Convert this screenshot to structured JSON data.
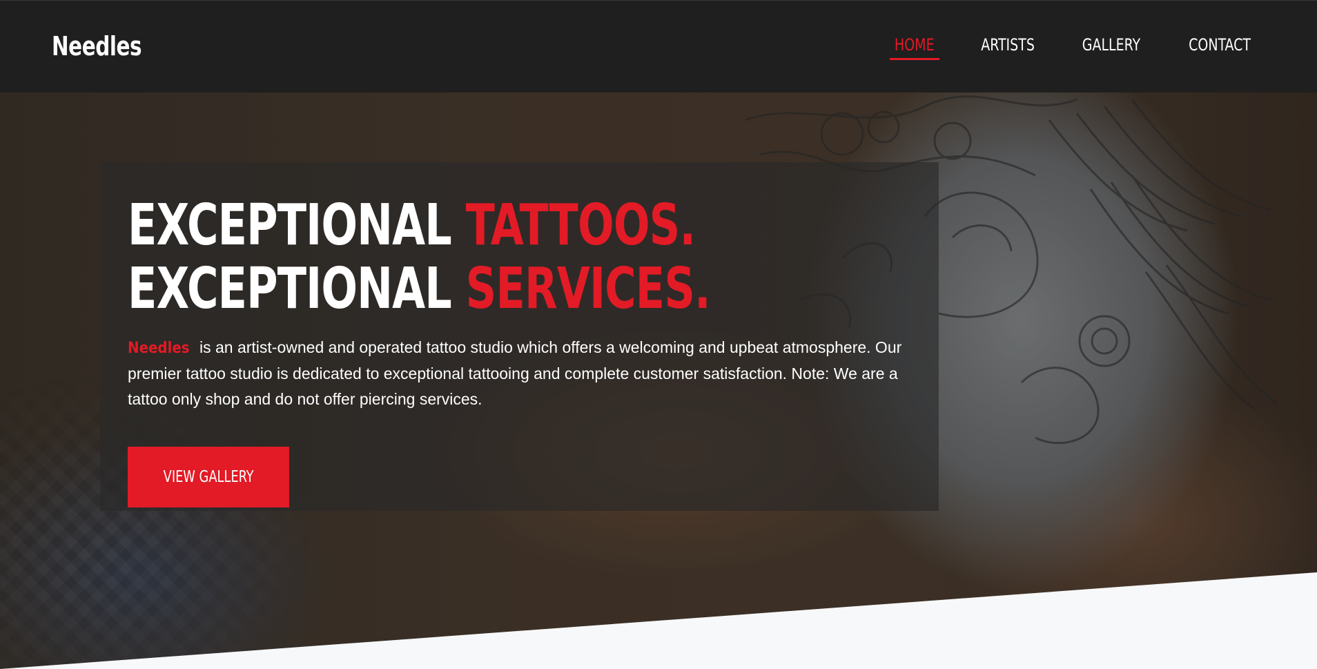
{
  "brand": {
    "name": "Needles"
  },
  "nav": {
    "items": [
      {
        "label": "HOME",
        "active": true
      },
      {
        "label": "ARTISTS",
        "active": false
      },
      {
        "label": "GALLERY",
        "active": false
      },
      {
        "label": "CONTACT",
        "active": false
      }
    ]
  },
  "hero": {
    "headline_line1_a": "EXCEPTIONAL ",
    "headline_line1_b": "TATTOOS.",
    "headline_line2_a": "EXCEPTIONAL ",
    "headline_line2_b": "SERVICES.",
    "description_brand": "Needles",
    "description_text": "is an artist-owned and operated tattoo studio which offers a welcoming and upbeat atmosphere. Our premier tattoo studio is dedicated to exceptional tattooing and complete customer satisfaction. Note: We are a tattoo only shop and do not offer piercing services.",
    "cta_label": "VIEW GALLERY"
  },
  "colors": {
    "accent": "#e21b26",
    "navbar_bg": "#1f1f1f",
    "page_bg": "#f7f8fa"
  }
}
